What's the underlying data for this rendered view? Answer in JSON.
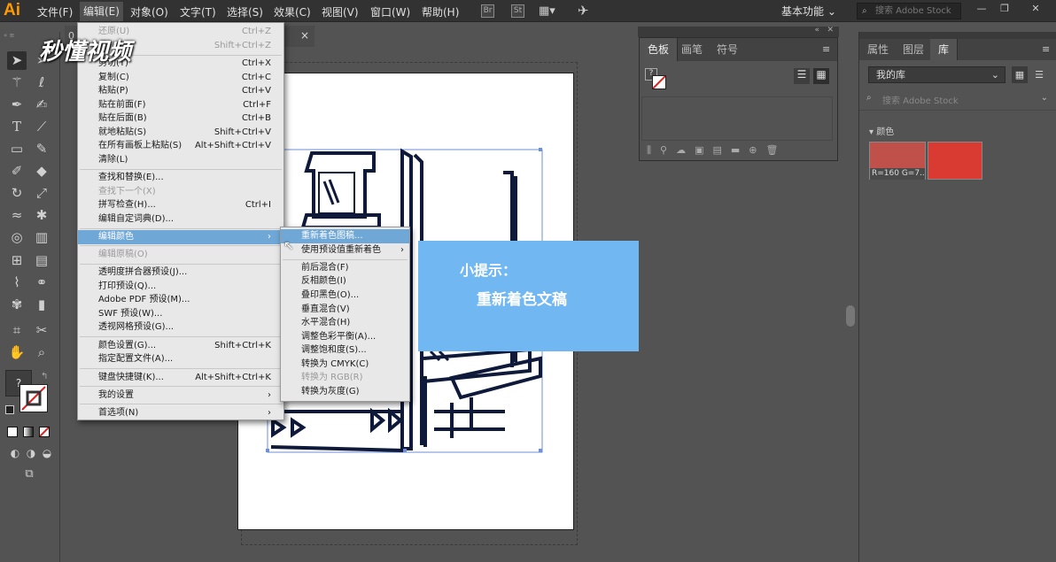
{
  "app": {
    "logo": "Ai"
  },
  "menubar": {
    "items": [
      "文件(F)",
      "编辑(E)",
      "对象(O)",
      "文字(T)",
      "选择(S)",
      "效果(C)",
      "视图(V)",
      "窗口(W)",
      "帮助(H)"
    ],
    "icons": [
      "Br",
      "St"
    ],
    "workspace": "基本功能",
    "search_placeholder": "搜索 Adobe Stock"
  },
  "document_tab": {
    "label": "0",
    "close": "×"
  },
  "edit_menu": {
    "items": [
      {
        "label": "还原(U)",
        "shortcut": "Ctrl+Z",
        "disabled": true
      },
      {
        "label": "重做(R)",
        "shortcut": "Shift+Ctrl+Z",
        "disabled": true
      },
      {
        "label": "剪切(T)",
        "shortcut": "Ctrl+X"
      },
      {
        "label": "复制(C)",
        "shortcut": "Ctrl+C"
      },
      {
        "label": "粘贴(P)",
        "shortcut": "Ctrl+V"
      },
      {
        "label": "贴在前面(F)",
        "shortcut": "Ctrl+F"
      },
      {
        "label": "贴在后面(B)",
        "shortcut": "Ctrl+B"
      },
      {
        "label": "就地粘贴(S)",
        "shortcut": "Shift+Ctrl+V"
      },
      {
        "label": "在所有画板上粘贴(S)",
        "shortcut": "Alt+Shift+Ctrl+V"
      },
      {
        "label": "清除(L)",
        "shortcut": ""
      },
      {
        "label": "查找和替换(E)...",
        "shortcut": ""
      },
      {
        "label": "查找下一个(X)",
        "shortcut": "",
        "disabled": true
      },
      {
        "label": "拼写检查(H)...",
        "shortcut": "Ctrl+I"
      },
      {
        "label": "编辑自定词典(D)...",
        "shortcut": ""
      },
      {
        "label": "编辑颜色",
        "shortcut": "›",
        "highlighted": true
      },
      {
        "label": "编辑原稿(O)",
        "shortcut": "",
        "disabled": true
      },
      {
        "label": "透明度拼合器预设(J)...",
        "shortcut": ""
      },
      {
        "label": "打印预设(Q)...",
        "shortcut": ""
      },
      {
        "label": "Adobe PDF 预设(M)...",
        "shortcut": ""
      },
      {
        "label": "SWF 预设(W)...",
        "shortcut": ""
      },
      {
        "label": "透视网格预设(G)...",
        "shortcut": ""
      },
      {
        "label": "颜色设置(G)...",
        "shortcut": "Shift+Ctrl+K"
      },
      {
        "label": "指定配置文件(A)...",
        "shortcut": ""
      },
      {
        "label": "键盘快捷键(K)...",
        "shortcut": "Alt+Shift+Ctrl+K"
      },
      {
        "label": "我的设置",
        "shortcut": "›"
      },
      {
        "label": "首选项(N)",
        "shortcut": "›"
      }
    ]
  },
  "edit_colors_submenu": {
    "items": [
      {
        "label": "重新着色图稿...",
        "highlighted": true
      },
      {
        "label": "使用预设值重新着色",
        "arrow": "›"
      },
      {
        "label": "前后混合(F)"
      },
      {
        "label": "反相颜色(I)"
      },
      {
        "label": "叠印黑色(O)..."
      },
      {
        "label": "垂直混合(V)"
      },
      {
        "label": "水平混合(H)"
      },
      {
        "label": "调整色彩平衡(A)..."
      },
      {
        "label": "调整饱和度(S)..."
      },
      {
        "label": "转换为 CMYK(C)"
      },
      {
        "label": "转换为 RGB(R)",
        "disabled": true
      },
      {
        "label": "转换为灰度(G)"
      }
    ]
  },
  "tip": {
    "title": "小提示：",
    "body": "重新着色文稿"
  },
  "watermark": "秒懂视频",
  "swatches_panel": {
    "tabs": [
      "色板",
      "画笔",
      "符号"
    ],
    "none_label": "?"
  },
  "right_panel": {
    "tabs": [
      "属性",
      "图层",
      "库"
    ],
    "library_select": "我的库",
    "search_placeholder": "搜索 Adobe Stock",
    "section": "颜色",
    "swatch_label": "R=160 G=7...",
    "colors": {
      "swatch1": "#c0504a",
      "swatch2": "#d93a32"
    }
  },
  "toolbar": {
    "none_label": "?"
  }
}
